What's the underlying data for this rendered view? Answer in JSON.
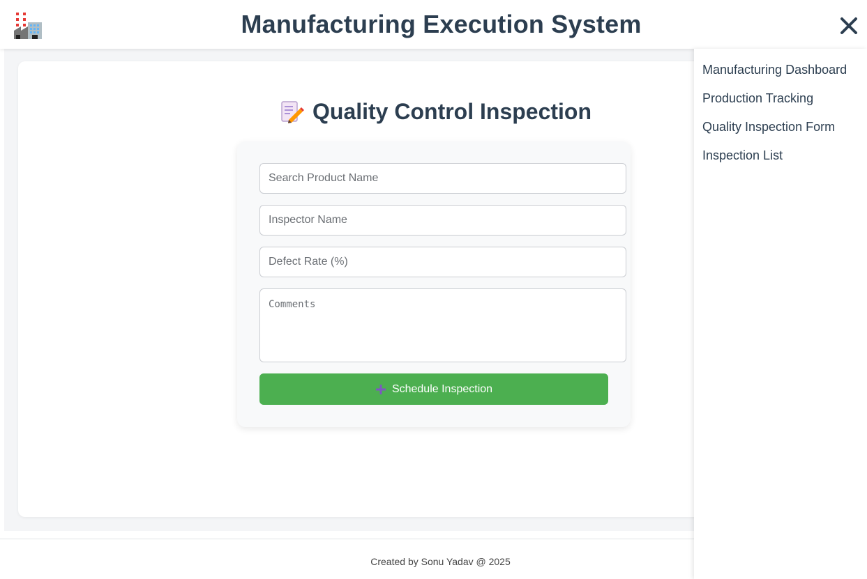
{
  "header": {
    "title": "Manufacturing Execution System",
    "logo_icon": "factory-icon",
    "close_icon": "close-icon"
  },
  "main": {
    "heading": "Quality Control Inspection",
    "heading_icon": "memo-icon",
    "form": {
      "product_search_placeholder": "Search Product Name",
      "inspector_placeholder": "Inspector Name",
      "defect_rate_placeholder": "Defect Rate (%)",
      "comments_placeholder": "Comments",
      "submit_label": "Schedule Inspection",
      "submit_icon": "plus-icon",
      "submit_color": "#4caf50"
    }
  },
  "side_menu": {
    "items": [
      {
        "label": "Manufacturing Dashboard"
      },
      {
        "label": "Production Tracking"
      },
      {
        "label": "Quality Inspection Form"
      },
      {
        "label": "Inspection List"
      }
    ]
  },
  "footer": {
    "text": "Created by Sonu Yadav @ 2025"
  },
  "colors": {
    "text": "#2c3e50",
    "accent": "#4caf50",
    "background": "#f4f5f7"
  }
}
